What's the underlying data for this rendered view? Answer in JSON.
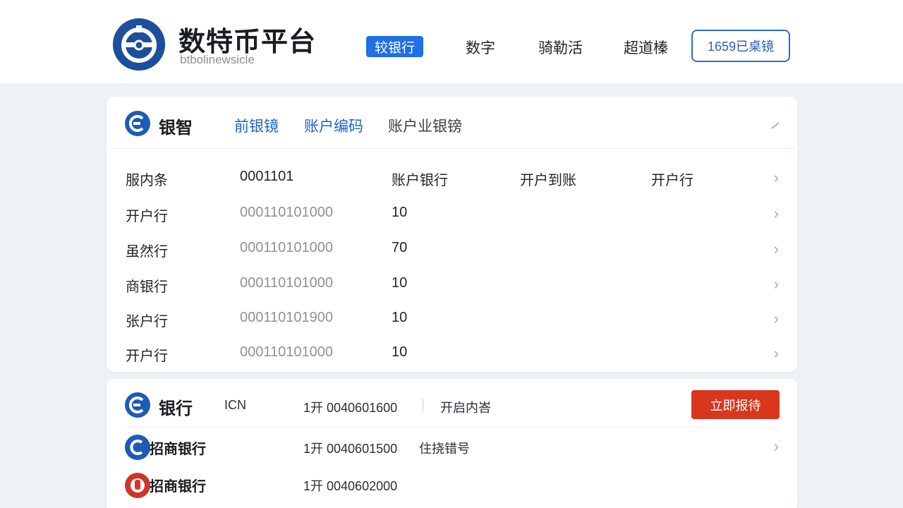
{
  "header": {
    "title": "数特币平台",
    "subtitle": "btbolinewsicle",
    "nav": [
      "较银行",
      "数字",
      "骑勒活",
      "超道榛"
    ],
    "cta": "1659已桌镜"
  },
  "card1": {
    "title": "银智",
    "tabs": [
      "前银镜",
      "账户编码",
      "账户业银镑"
    ],
    "header_row": [
      "服内条",
      "0001101",
      "账户银行",
      "开户到账",
      "开户行"
    ],
    "rows": [
      {
        "label": "开户行",
        "code": "000110101000",
        "value": "10"
      },
      {
        "label": "虽然行",
        "code": "000110101000",
        "value": "70"
      },
      {
        "label": "商银行",
        "code": "000110101000",
        "value": "10"
      },
      {
        "label": "张户行",
        "code": "000110101900",
        "value": "10"
      },
      {
        "label": "开户行",
        "code": "000110101000",
        "value": "10"
      }
    ]
  },
  "card2": {
    "title": "银行",
    "col": "ICN",
    "head_code": "1开 0040601600",
    "head_note": "开启内峇",
    "action": "立即报待",
    "rows": [
      {
        "name": "招商银行",
        "code": "1开 0040601500",
        "note": "住挠错号",
        "logo": "blue"
      },
      {
        "name": "招商银行",
        "code": "1开 0040602000",
        "note": "",
        "logo": "red"
      }
    ]
  },
  "colors": {
    "brand": "#1d4f9c",
    "accent": "#1f6fe5",
    "action": "#d9361e"
  },
  "icons": {
    "brand_logo": "coin-logo-icon",
    "chevron": "chevron-right-icon",
    "collapse": "collapse-icon"
  }
}
